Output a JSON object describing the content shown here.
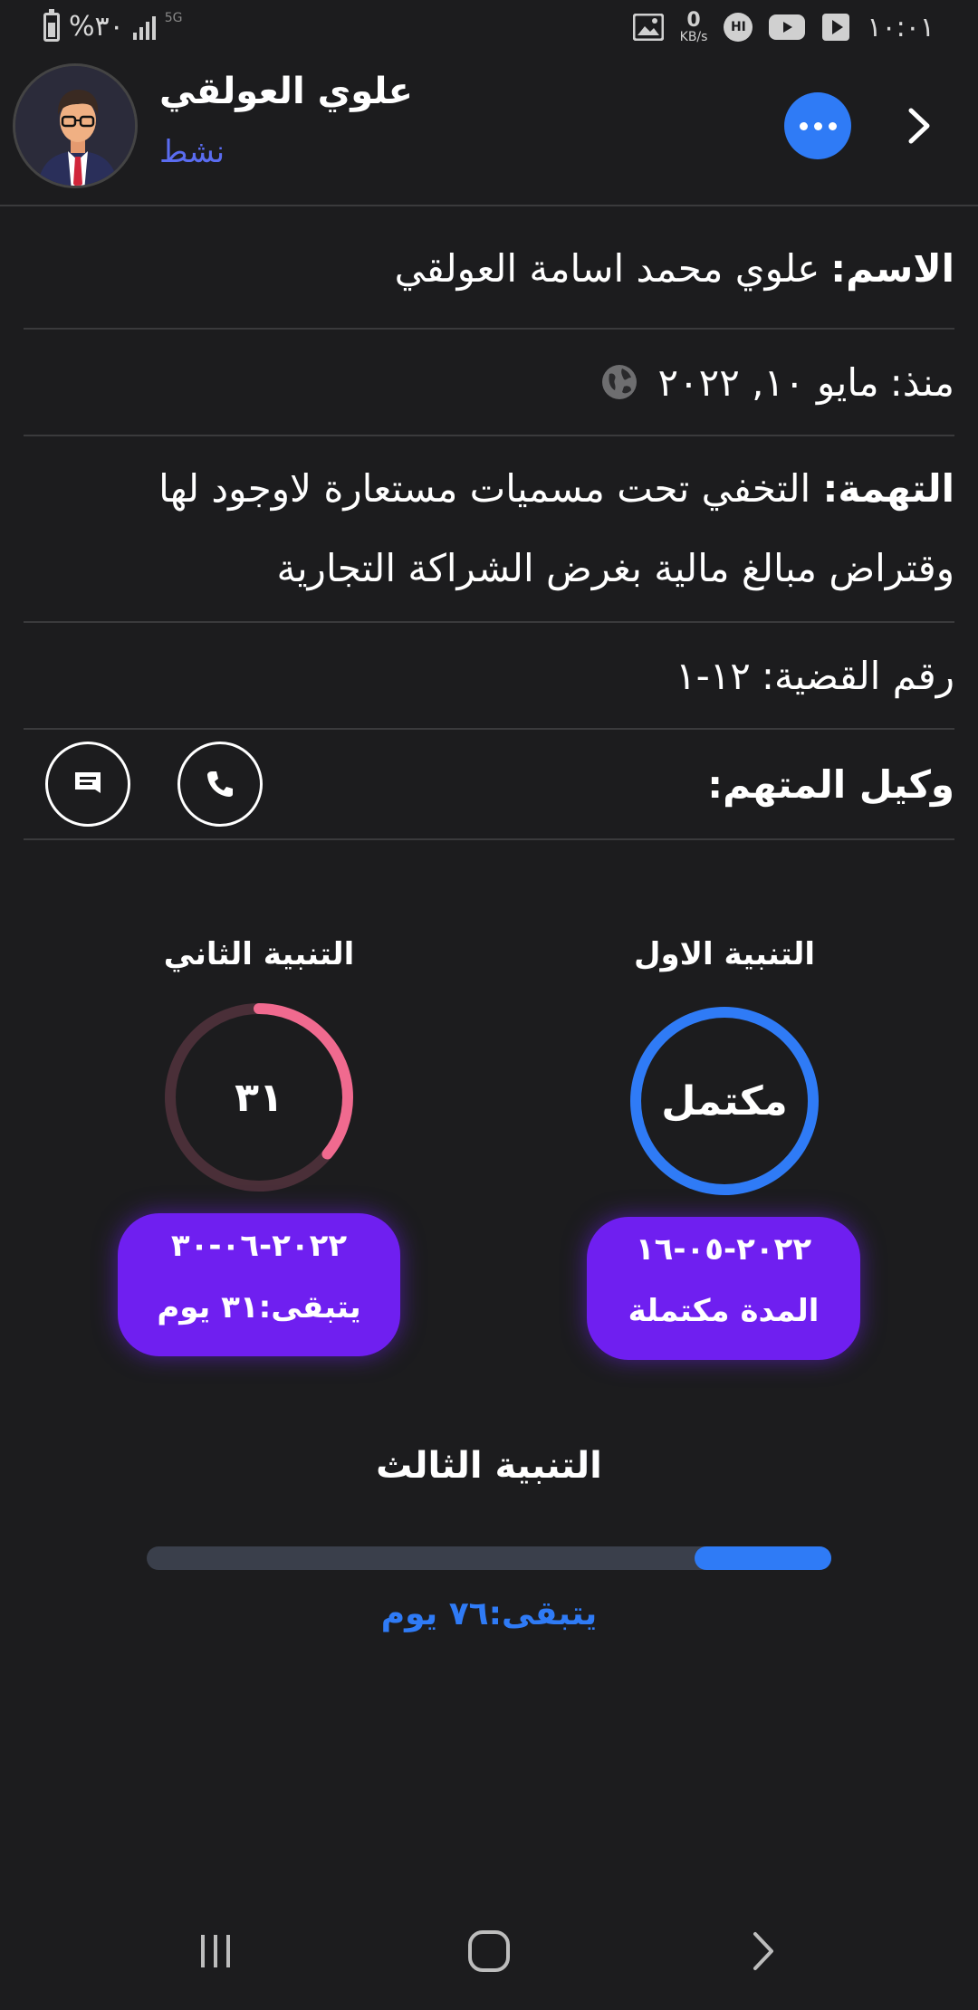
{
  "status_bar": {
    "battery_text": "%٣٠",
    "network_type": "5G",
    "net_speed_value": "0",
    "net_speed_unit": "KB/s",
    "hi_badge": "HI",
    "time": "١٠:٠١"
  },
  "header": {
    "contact_name": "علوي العولقي",
    "status": "نشط"
  },
  "info": {
    "name_label": "الاسم:",
    "name_value": "علوي محمد اسامة العولقي",
    "since_label": "منذ:",
    "since_value": "مايو ١٠, ٢٠٢٢",
    "charge_label": "التهمة:",
    "charge_value": "التخفي تحت مسميات مستعارة لاوجود لها وقتراض مبالغ مالية بغرض الشراكة التجارية",
    "case_label": "رقم القضية:",
    "case_value": "١٢-١",
    "agent_label": "وكيل المتهم:"
  },
  "warnings": {
    "first": {
      "title": "التنبية الاول",
      "ring_text": "مكتمل",
      "date": "٢٠٢٢-٠٥-١٦",
      "status_text": "المدة مكتملة",
      "progress": 1.0,
      "ring_color": "#2f7bf6"
    },
    "second": {
      "title": "التنبية الثاني",
      "ring_text": "٣١",
      "date": "٢٠٢٢-٠٦-٣٠",
      "remaining_text": "يتبقى:٣١ يوم",
      "progress": 0.36,
      "ring_color": "#f06a8f",
      "track_color": "#4a2f38"
    },
    "third": {
      "title": "التنبية الثالث",
      "remaining_text": "يتبقى:٧٦ يوم",
      "progress": 0.2,
      "bar_color": "#2f7bf6"
    }
  },
  "colors": {
    "background": "#1c1c1e",
    "accent_blue": "#2f7bf6",
    "card_purple": "#6f1ff0",
    "status_text": "#5a6cf0"
  },
  "icons": {
    "more": "more-horizontal-icon",
    "back": "chevron-right-icon",
    "globe": "globe-icon",
    "phone": "phone-icon",
    "message": "message-icon"
  }
}
